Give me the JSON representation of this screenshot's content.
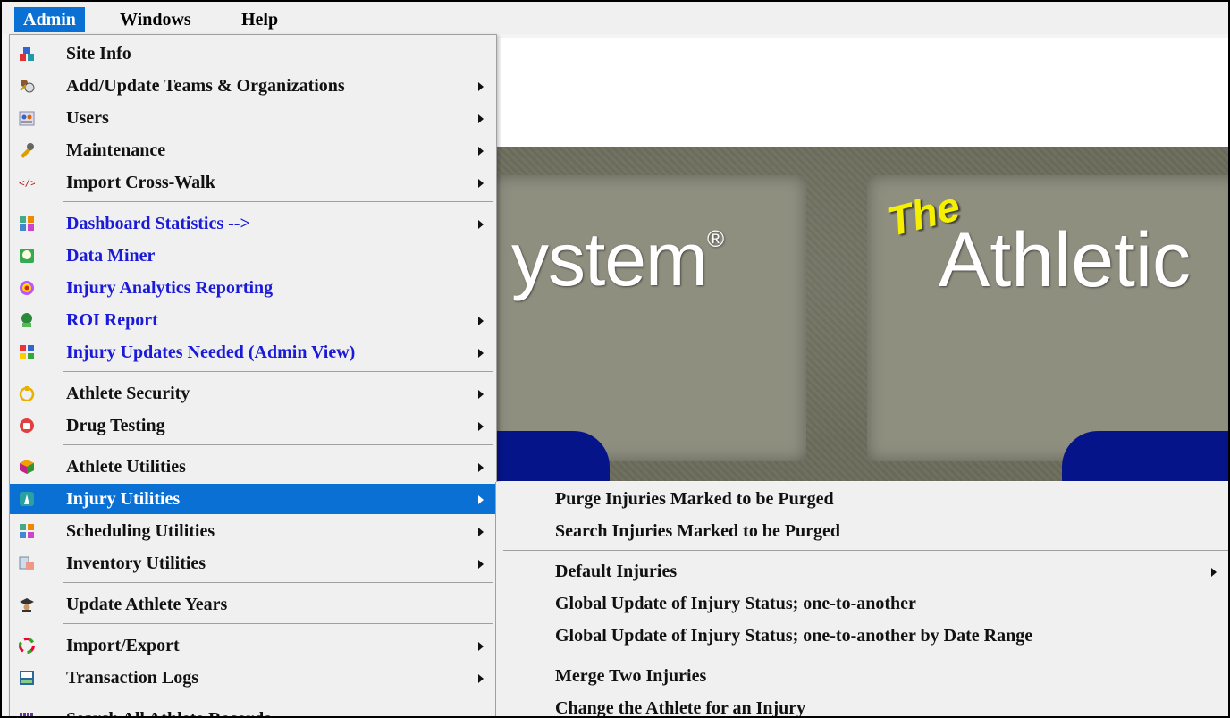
{
  "menubar": {
    "items": [
      {
        "label": "Admin"
      },
      {
        "label": "Windows"
      },
      {
        "label": "Help"
      }
    ]
  },
  "banner": {
    "left_text": "ystem",
    "reg_mark": "®",
    "the_text": "The",
    "right_text": "Athletic"
  },
  "admin_menu": {
    "items": [
      {
        "label": "Site Info",
        "icon": "site-info-icon",
        "submenu": false
      },
      {
        "label": "Add/Update Teams & Organizations",
        "icon": "teams-icon",
        "submenu": true
      },
      {
        "label": "Users",
        "icon": "users-icon",
        "submenu": true
      },
      {
        "label": "Maintenance",
        "icon": "maintenance-icon",
        "submenu": true
      },
      {
        "label": "Import Cross-Walk",
        "icon": "code-icon",
        "submenu": true
      },
      {
        "label": "Dashboard Statistics -->",
        "icon": "dashboard-icon",
        "submenu": true
      },
      {
        "label": "Data Miner",
        "icon": "data-miner-icon",
        "submenu": false
      },
      {
        "label": "Injury Analytics Reporting",
        "icon": "analytics-icon",
        "submenu": false
      },
      {
        "label": "ROI Report",
        "icon": "roi-icon",
        "submenu": true
      },
      {
        "label": "Injury Updates Needed (Admin View)",
        "icon": "updates-icon",
        "submenu": true
      },
      {
        "label": "Athlete Security",
        "icon": "security-icon",
        "submenu": true
      },
      {
        "label": "Drug Testing",
        "icon": "drug-testing-icon",
        "submenu": true
      },
      {
        "label": "Athlete Utilities",
        "icon": "athlete-utilities-icon",
        "submenu": true
      },
      {
        "label": "Injury Utilities",
        "icon": "injury-utilities-icon",
        "submenu": true
      },
      {
        "label": "Scheduling Utilities",
        "icon": "scheduling-icon",
        "submenu": true
      },
      {
        "label": "Inventory Utilities",
        "icon": "inventory-icon",
        "submenu": true
      },
      {
        "label": "Update Athlete Years",
        "icon": "graduation-icon",
        "submenu": false
      },
      {
        "label": "Import/Export",
        "icon": "import-export-icon",
        "submenu": true
      },
      {
        "label": "Transaction Logs",
        "icon": "logs-icon",
        "submenu": true
      },
      {
        "label": "Search All Athlete Records",
        "icon": "search-records-icon",
        "submenu": false
      }
    ]
  },
  "injury_submenu": {
    "items": [
      {
        "label": "Purge Injuries Marked to be Purged",
        "submenu": false
      },
      {
        "label": "Search Injuries Marked to be Purged",
        "submenu": false
      },
      {
        "label": "Default Injuries",
        "submenu": true
      },
      {
        "label": "Global Update of Injury Status; one-to-another",
        "submenu": false
      },
      {
        "label": "Global Update of Injury Status; one-to-another by Date Range",
        "submenu": false
      },
      {
        "label": "Merge Two Injuries",
        "submenu": false
      },
      {
        "label": "Change the Athlete for an Injury",
        "submenu": false
      }
    ]
  },
  "colors": {
    "menu_highlight": "#0b70d4",
    "link_text": "#1a1ad8",
    "menu_bg": "#f0f0f0"
  }
}
